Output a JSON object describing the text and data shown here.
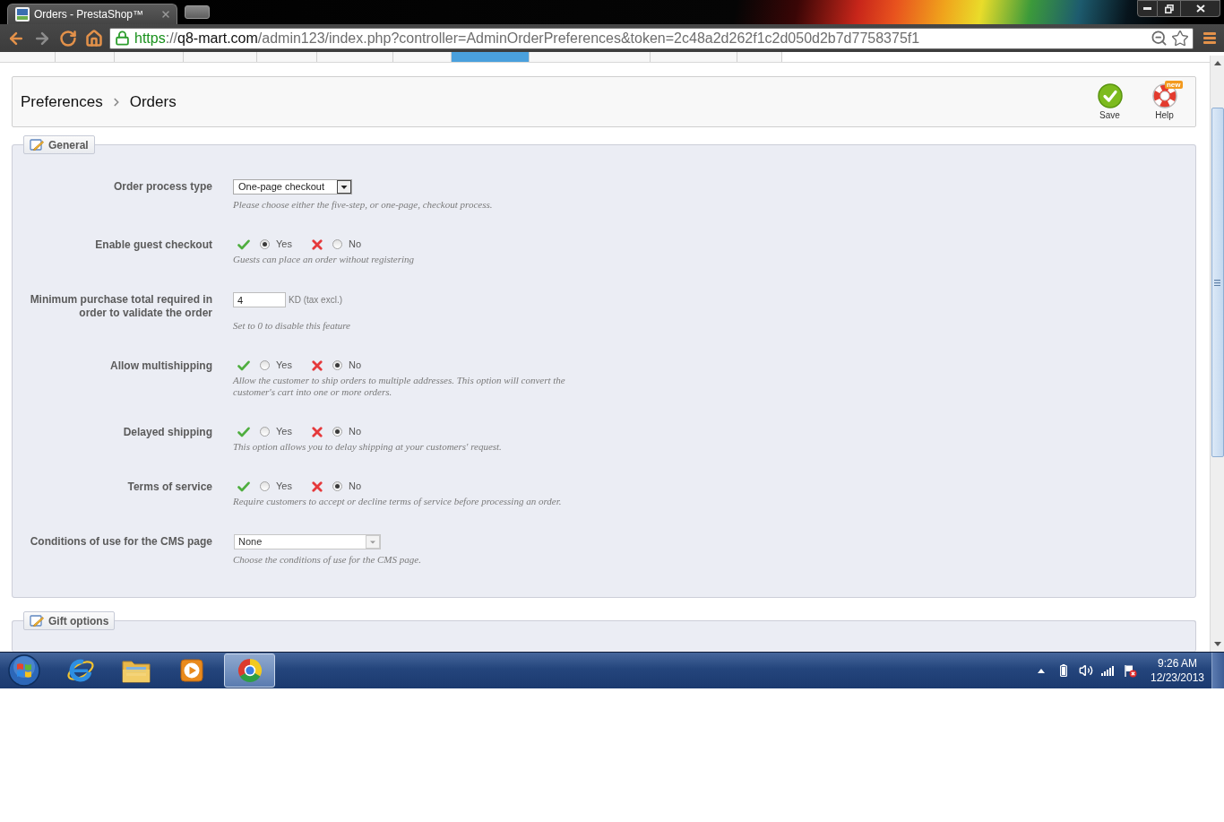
{
  "browser": {
    "tab_title": "Orders - PrestaShop™",
    "nav_buttons": [
      {
        "kind": "back",
        "disabled": false
      },
      {
        "kind": "forward",
        "disabled": true
      },
      {
        "kind": "reload",
        "disabled": false
      },
      {
        "kind": "home",
        "disabled": false
      }
    ],
    "url_parts": [
      {
        "kind": "scheme",
        "text": "https"
      },
      {
        "kind": "plain",
        "text": "://"
      },
      {
        "kind": "host",
        "text": "q8-mart.com"
      },
      {
        "kind": "plain",
        "text": "/admin123/index.php?controller=AdminOrderPreferences&token=2c48a2d262f1c2d050d2b7d7758375f1"
      }
    ],
    "bookmarked": false
  },
  "top_menu": [
    {
      "selected": false
    },
    {
      "selected": false
    },
    {
      "selected": false
    },
    {
      "selected": false
    },
    {
      "selected": false
    },
    {
      "selected": false
    },
    {
      "selected": false
    },
    {
      "selected": true
    },
    {
      "selected": false
    },
    {
      "selected": false
    },
    {
      "selected": false
    }
  ],
  "header": {
    "breadcrumb": [
      "Preferences",
      "Orders"
    ],
    "toolbar": [
      {
        "kind": "save",
        "label": "Save"
      },
      {
        "kind": "help",
        "label": "Help",
        "badge": "new"
      }
    ]
  },
  "sections": [
    {
      "title": "General",
      "fields": [
        {
          "kind": "select",
          "label": "Order process type",
          "value": "One-page checkout",
          "hint": "Please choose either the five-step, or one-page, checkout process."
        },
        {
          "kind": "radio",
          "label": "Enable guest checkout",
          "options": [
            {
              "kind": "yes",
              "label": "Yes",
              "selected": true
            },
            {
              "kind": "no",
              "label": "No",
              "selected": false
            }
          ],
          "hint": "Guests can place an order without registering"
        },
        {
          "kind": "amount",
          "label": "Minimum purchase total required in order to validate the order",
          "value": "4",
          "suffix": "KD (tax excl.)",
          "hint": "Set to 0 to disable this feature"
        },
        {
          "kind": "radio",
          "label": "Allow multishipping",
          "options": [
            {
              "kind": "yes",
              "label": "Yes",
              "selected": false
            },
            {
              "kind": "no",
              "label": "No",
              "selected": true
            }
          ],
          "hint": "Allow the customer to ship orders to multiple addresses. This option will convert the customer's cart into one or more orders."
        },
        {
          "kind": "radio",
          "label": "Delayed shipping",
          "options": [
            {
              "kind": "yes",
              "label": "Yes",
              "selected": false
            },
            {
              "kind": "no",
              "label": "No",
              "selected": true
            }
          ],
          "hint": "This option allows you to delay shipping at your customers' request."
        },
        {
          "kind": "radio",
          "label": "Terms of service",
          "options": [
            {
              "kind": "yes",
              "label": "Yes",
              "selected": false
            },
            {
              "kind": "no",
              "label": "No",
              "selected": true
            }
          ],
          "hint": "Require customers to accept or decline terms of service before processing an order."
        },
        {
          "kind": "dropdown",
          "label": "Conditions of use for the CMS page",
          "value": "None",
          "hint": "Choose the conditions of use for the CMS page."
        }
      ]
    },
    {
      "title": "Gift options"
    }
  ],
  "taskbar": {
    "apps": [
      {
        "kind": "ie",
        "selected": false
      },
      {
        "kind": "explorer",
        "selected": false
      },
      {
        "kind": "media",
        "selected": false
      },
      {
        "kind": "chrome",
        "selected": true
      }
    ],
    "time": "9:26 AM",
    "date": "12/23/2013"
  }
}
